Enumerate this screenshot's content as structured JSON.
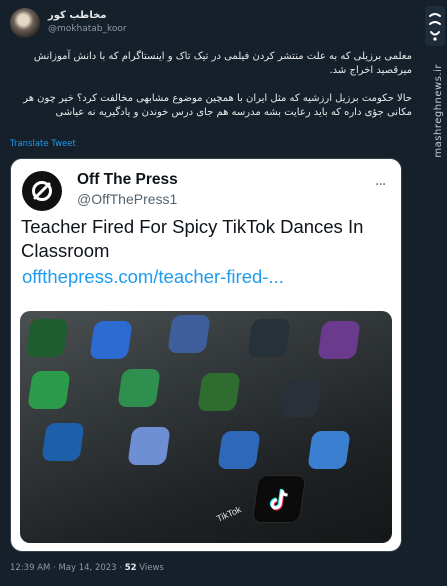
{
  "author": {
    "display_name": "مخاطب کور",
    "handle": "@mokhatab_koor"
  },
  "tweet": {
    "paragraph1": "معلمی برزیلی که به علت منتشر کردن فیلمی در تیک تاک و اینستاگرام که با دانش آموزانش میرقصید اخراج شد.",
    "paragraph2": "حالا حکومت برزیل ارزشیه که مثل ایران با همچین موضوع مشابهی مخالفت کرد؟ خیر چون هر مکانی جؤی داره که باید رعایت بشه مدرسه هم جای درس خوندن و یادگیریه نه عیاشی",
    "translate_label": "Translate Tweet"
  },
  "card": {
    "author_name": "Off The Press",
    "author_handle": "@OffThePress1",
    "more_icon": "more-dots-icon",
    "headline": "Teacher Fired For Spicy TikTok Dances In Classroom",
    "link": "offthepress.com/teacher-fired-...",
    "image_label": "TikTok"
  },
  "meta": {
    "time": "12:39 AM",
    "separator": "·",
    "date": "May 14, 2023",
    "views_count": "52",
    "views_label": "Views"
  },
  "brand": {
    "logo_text": "مشرق",
    "watermark": "mashreghnews.ir"
  },
  "colors": {
    "background": "#15202b",
    "accent": "#1d9bf0",
    "text": "#e7e9ea",
    "muted": "#8b98a5"
  }
}
